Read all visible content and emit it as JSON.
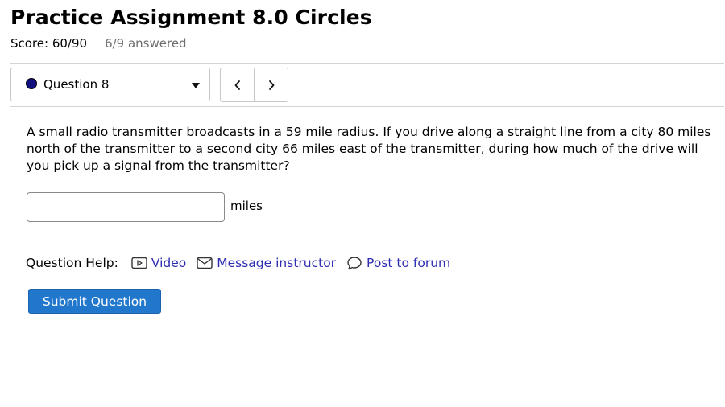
{
  "assignment": {
    "title": "Practice Assignment 8.0 Circles",
    "score": "Score: 60/90",
    "answered": "6/9 answered"
  },
  "question_nav": {
    "selected": "Question 8",
    "status_color": "#10107e",
    "prev_icon": "chevron-left-icon",
    "next_icon": "chevron-right-icon"
  },
  "question": {
    "text": "A small radio transmitter broadcasts in a 59 mile radius. If you drive along a straight line from a city 80 miles north of the transmitter to a second city 66 miles east of the transmitter, during how much of the drive will you pick up a signal from the transmitter?",
    "answer_value": "",
    "unit": "miles"
  },
  "help": {
    "label": "Question Help:",
    "links": [
      {
        "label": "Video",
        "icon": "video-icon"
      },
      {
        "label": "Message instructor",
        "icon": "envelope-icon"
      },
      {
        "label": "Post to forum",
        "icon": "speech-bubble-icon"
      }
    ]
  },
  "submit_label": "Submit Question",
  "colors": {
    "link": "#2d2db3",
    "submit_bg": "#2177cc"
  }
}
